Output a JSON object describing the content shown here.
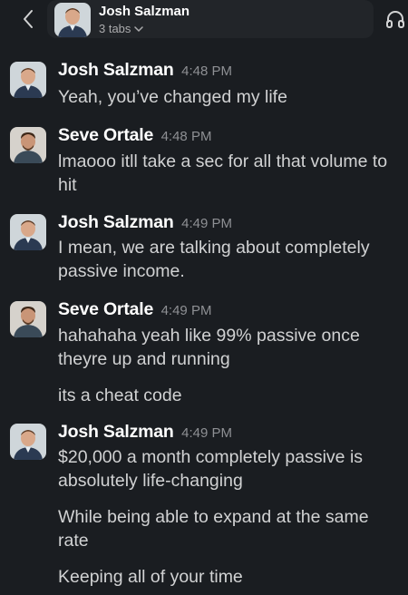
{
  "header": {
    "name": "Josh Salzman",
    "tabs": "3 tabs"
  },
  "messages": [
    {
      "sender": "Josh Salzman",
      "time": "4:48 PM",
      "avatar": "josh-avatar",
      "texts": [
        "Yeah, you’ve changed my life"
      ]
    },
    {
      "sender": "Seve Ortale",
      "time": "4:48 PM",
      "avatar": "seve-avatar",
      "texts": [
        "lmaooo itll take a sec for all that volume to hit"
      ]
    },
    {
      "sender": "Josh Salzman",
      "time": "4:49 PM",
      "avatar": "josh-avatar",
      "texts": [
        "I mean, we are talking about completely passive income."
      ]
    },
    {
      "sender": "Seve Ortale",
      "time": "4:49 PM",
      "avatar": "seve-avatar",
      "texts": [
        "hahahaha yeah like 99% passive once theyre up and running",
        "its a cheat code"
      ]
    },
    {
      "sender": "Josh Salzman",
      "time": "4:49 PM",
      "avatar": "josh-avatar",
      "texts": [
        "$20,000 a month completely passive is absolutely life-changing",
        "While being able to expand at the same rate",
        "Keeping all of your time"
      ]
    }
  ],
  "colors": {
    "background": "#1a1d21",
    "sender": "#ffffff",
    "body_text": "#d1d2d3",
    "timestamp": "#8e9094"
  }
}
